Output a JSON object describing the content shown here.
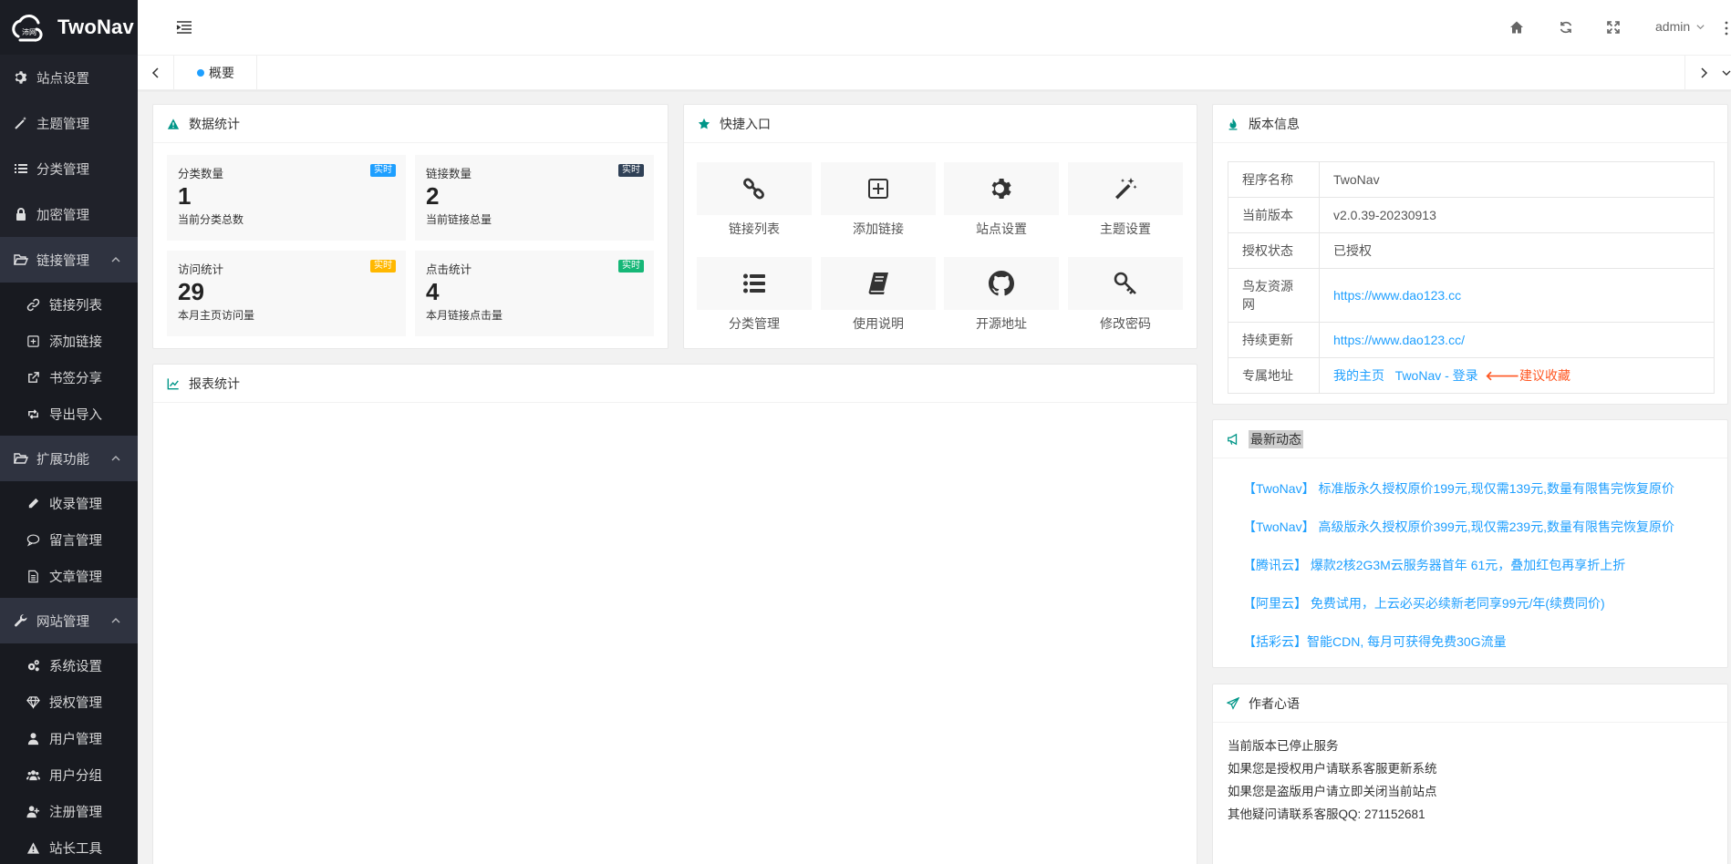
{
  "app": {
    "title": "TwoNav",
    "logo_text": "TwoNav"
  },
  "sidebar": {
    "items": [
      {
        "label": "站点设置",
        "icon": "gear-icon"
      },
      {
        "label": "主题管理",
        "icon": "wand-icon"
      },
      {
        "label": "分类管理",
        "icon": "list-icon"
      },
      {
        "label": "加密管理",
        "icon": "lock-icon"
      }
    ],
    "groups": [
      {
        "label": "链接管理",
        "icon": "folder-open-icon",
        "expanded": true,
        "children": [
          {
            "label": "链接列表",
            "icon": "link-icon"
          },
          {
            "label": "添加链接",
            "icon": "plus-square-icon"
          },
          {
            "label": "书签分享",
            "icon": "external-link-icon"
          },
          {
            "label": "导出导入",
            "icon": "retweet-icon"
          }
        ]
      },
      {
        "label": "扩展功能",
        "icon": "folder-open-icon",
        "expanded": true,
        "children": [
          {
            "label": "收录管理",
            "icon": "pencil-icon"
          },
          {
            "label": "留言管理",
            "icon": "comment-icon"
          },
          {
            "label": "文章管理",
            "icon": "file-text-icon"
          }
        ]
      },
      {
        "label": "网站管理",
        "icon": "wrench-icon",
        "expanded": true,
        "children": [
          {
            "label": "系统设置",
            "icon": "cogs-icon"
          },
          {
            "label": "授权管理",
            "icon": "diamond-icon"
          },
          {
            "label": "用户管理",
            "icon": "user-icon"
          },
          {
            "label": "用户分组",
            "icon": "users-icon"
          },
          {
            "label": "注册管理",
            "icon": "user-plus-icon"
          },
          {
            "label": "站长工具",
            "icon": "warning-icon"
          }
        ]
      }
    ]
  },
  "header": {
    "user": "admin"
  },
  "tabs": [
    {
      "label": "概要",
      "active": true
    }
  ],
  "stats": {
    "title": "数据统计",
    "cards": [
      {
        "label": "分类数量",
        "value": "1",
        "desc": "当前分类总数",
        "badge": "实时",
        "badge_color": "#1e9fff"
      },
      {
        "label": "链接数量",
        "value": "2",
        "desc": "当前链接总量",
        "badge": "实时",
        "badge_color": "#2f4056"
      },
      {
        "label": "访问统计",
        "value": "29",
        "desc": "本月主页访问量",
        "badge": "实时",
        "badge_color": "#ffb800"
      },
      {
        "label": "点击统计",
        "value": "4",
        "desc": "本月链接点击量",
        "badge": "实时",
        "badge_color": "#16b777"
      }
    ]
  },
  "quick": {
    "title": "快捷入口",
    "items": [
      {
        "label": "链接列表",
        "icon": "link-icon"
      },
      {
        "label": "添加链接",
        "icon": "plus-square-icon"
      },
      {
        "label": "站点设置",
        "icon": "gear-icon"
      },
      {
        "label": "主题设置",
        "icon": "magic-wand-icon"
      },
      {
        "label": "分类管理",
        "icon": "list-icon"
      },
      {
        "label": "使用说明",
        "icon": "book-icon"
      },
      {
        "label": "开源地址",
        "icon": "github-icon"
      },
      {
        "label": "修改密码",
        "icon": "key-icon"
      }
    ]
  },
  "report": {
    "title": "报表统计"
  },
  "version": {
    "title": "版本信息",
    "rows": [
      {
        "key": "程序名称",
        "value": "TwoNav"
      },
      {
        "key": "当前版本",
        "value": "v2.0.39-20230913"
      },
      {
        "key": "授权状态",
        "value": "已授权"
      },
      {
        "key": "鸟友资源网",
        "value": "https://www.dao123.cc"
      },
      {
        "key": "持续更新",
        "value": "https://www.dao123.cc/"
      },
      {
        "key": "专属地址",
        "links": [
          "我的主页",
          "TwoNav - 登录",
          "建议收藏"
        ]
      }
    ]
  },
  "news": {
    "title": "最新动态",
    "items": [
      "【TwoNav】 标准版永久授权原价199元,现仅需139元,数量有限售完恢复原价",
      "【TwoNav】 高级版永久授权原价399元,现仅需239元,数量有限售完恢复原价",
      "【腾讯云】 爆款2核2G3M云服务器首年 61元，叠加红包再享折上折",
      "【阿里云】 免费试用，上云必买必续新老同享99元/年(续费同价)",
      "【括彩云】智能CDN, 每月可获得免费30G流量"
    ]
  },
  "author": {
    "title": "作者心语",
    "lines": [
      "当前版本已停止服务",
      "如果您是授权用户请联系客服更新系统",
      "如果您是盗版用户请立即关闭当前站点",
      "其他疑问请联系客服QQ: 271152681"
    ]
  },
  "colors": {
    "sidebar": "#20222a",
    "accent": "#009688",
    "link": "#1e9fff",
    "warn": "#ff5722"
  }
}
